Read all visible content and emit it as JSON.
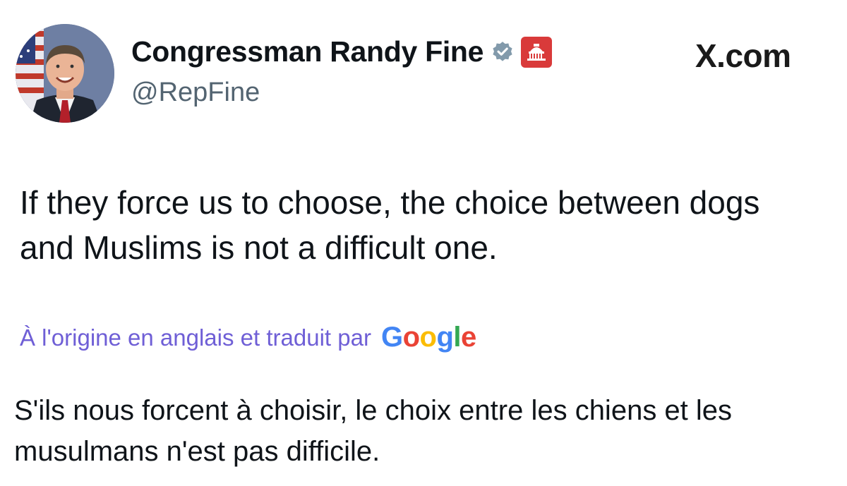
{
  "profile": {
    "display_name": "Congressman Randy Fine",
    "handle": "@RepFine",
    "avatar_icon": "profile-photo",
    "verified_icon": "verified-badge-icon",
    "affiliation_icon": "capitol-affiliation-icon",
    "affiliation_color": "#d93a3a"
  },
  "brand": {
    "site_label": "X.com"
  },
  "tweet": {
    "text": "If they force us to choose, the choice between dogs and Muslims is not a difficult one."
  },
  "translation": {
    "note": "À l'origine en anglais et traduit par",
    "provider_letters": [
      "G",
      "o",
      "o",
      "g",
      "l",
      "e"
    ],
    "provider_colors": [
      "#4285F4",
      "#EA4335",
      "#FBBC05",
      "#4285F4",
      "#34A853",
      "#EA4335"
    ],
    "note_color": "#6f5fd6",
    "text": "S'ils nous forcent à choisir, le choix entre les chiens et les musulmans n'est pas difficile."
  }
}
